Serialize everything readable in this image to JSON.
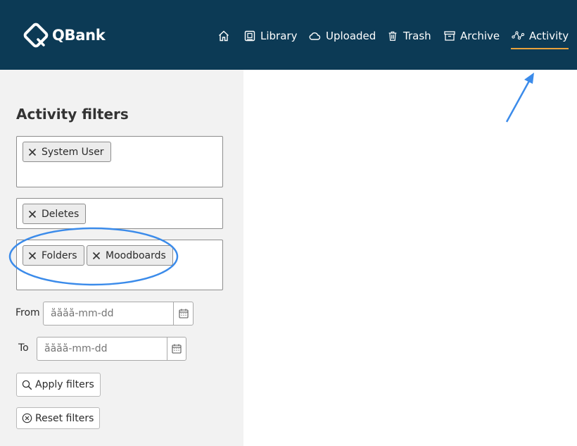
{
  "app": {
    "name": "QBank"
  },
  "nav": {
    "items": [
      {
        "label": "Library",
        "icon": "library-icon"
      },
      {
        "label": "Uploaded",
        "icon": "cloud-icon"
      },
      {
        "label": "Trash",
        "icon": "trash-icon"
      },
      {
        "label": "Archive",
        "icon": "archive-icon"
      },
      {
        "label": "Activity",
        "icon": "activity-icon",
        "active": true
      }
    ],
    "home_icon": "home-icon"
  },
  "filters": {
    "title": "Activity filters",
    "users": [
      "System User"
    ],
    "actions": [
      "Deletes"
    ],
    "types": [
      "Folders",
      "Moodboards"
    ],
    "from_label": "From",
    "to_label": "To",
    "date_placeholder": "åååå-mm-dd",
    "apply_label": "Apply filters",
    "reset_label": "Reset filters"
  },
  "colors": {
    "header_bg": "#0c3a55",
    "active_underline": "#e8a23c",
    "annotation": "#3b8bea"
  }
}
